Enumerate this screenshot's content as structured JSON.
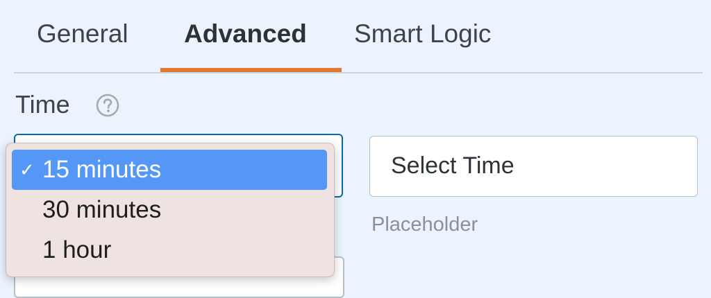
{
  "tabs": [
    {
      "label": "General",
      "active": false
    },
    {
      "label": "Advanced",
      "active": true
    },
    {
      "label": "Smart Logic",
      "active": false
    }
  ],
  "colors": {
    "accent": "#e27730",
    "selected_option": "#5597f7",
    "focus_border": "#056aab",
    "background": "#ebf3fc"
  },
  "field": {
    "label": "Time",
    "help_icon": "question-circle-icon"
  },
  "interval_select": {
    "selected_value": "15 minutes",
    "check_mark": "✓",
    "options": [
      {
        "label": "15 minutes",
        "selected": true
      },
      {
        "label": "30 minutes",
        "selected": false
      },
      {
        "label": "1 hour",
        "selected": false
      }
    ]
  },
  "placeholder_input": {
    "value": "Select Time",
    "sublabel": "Placeholder"
  }
}
